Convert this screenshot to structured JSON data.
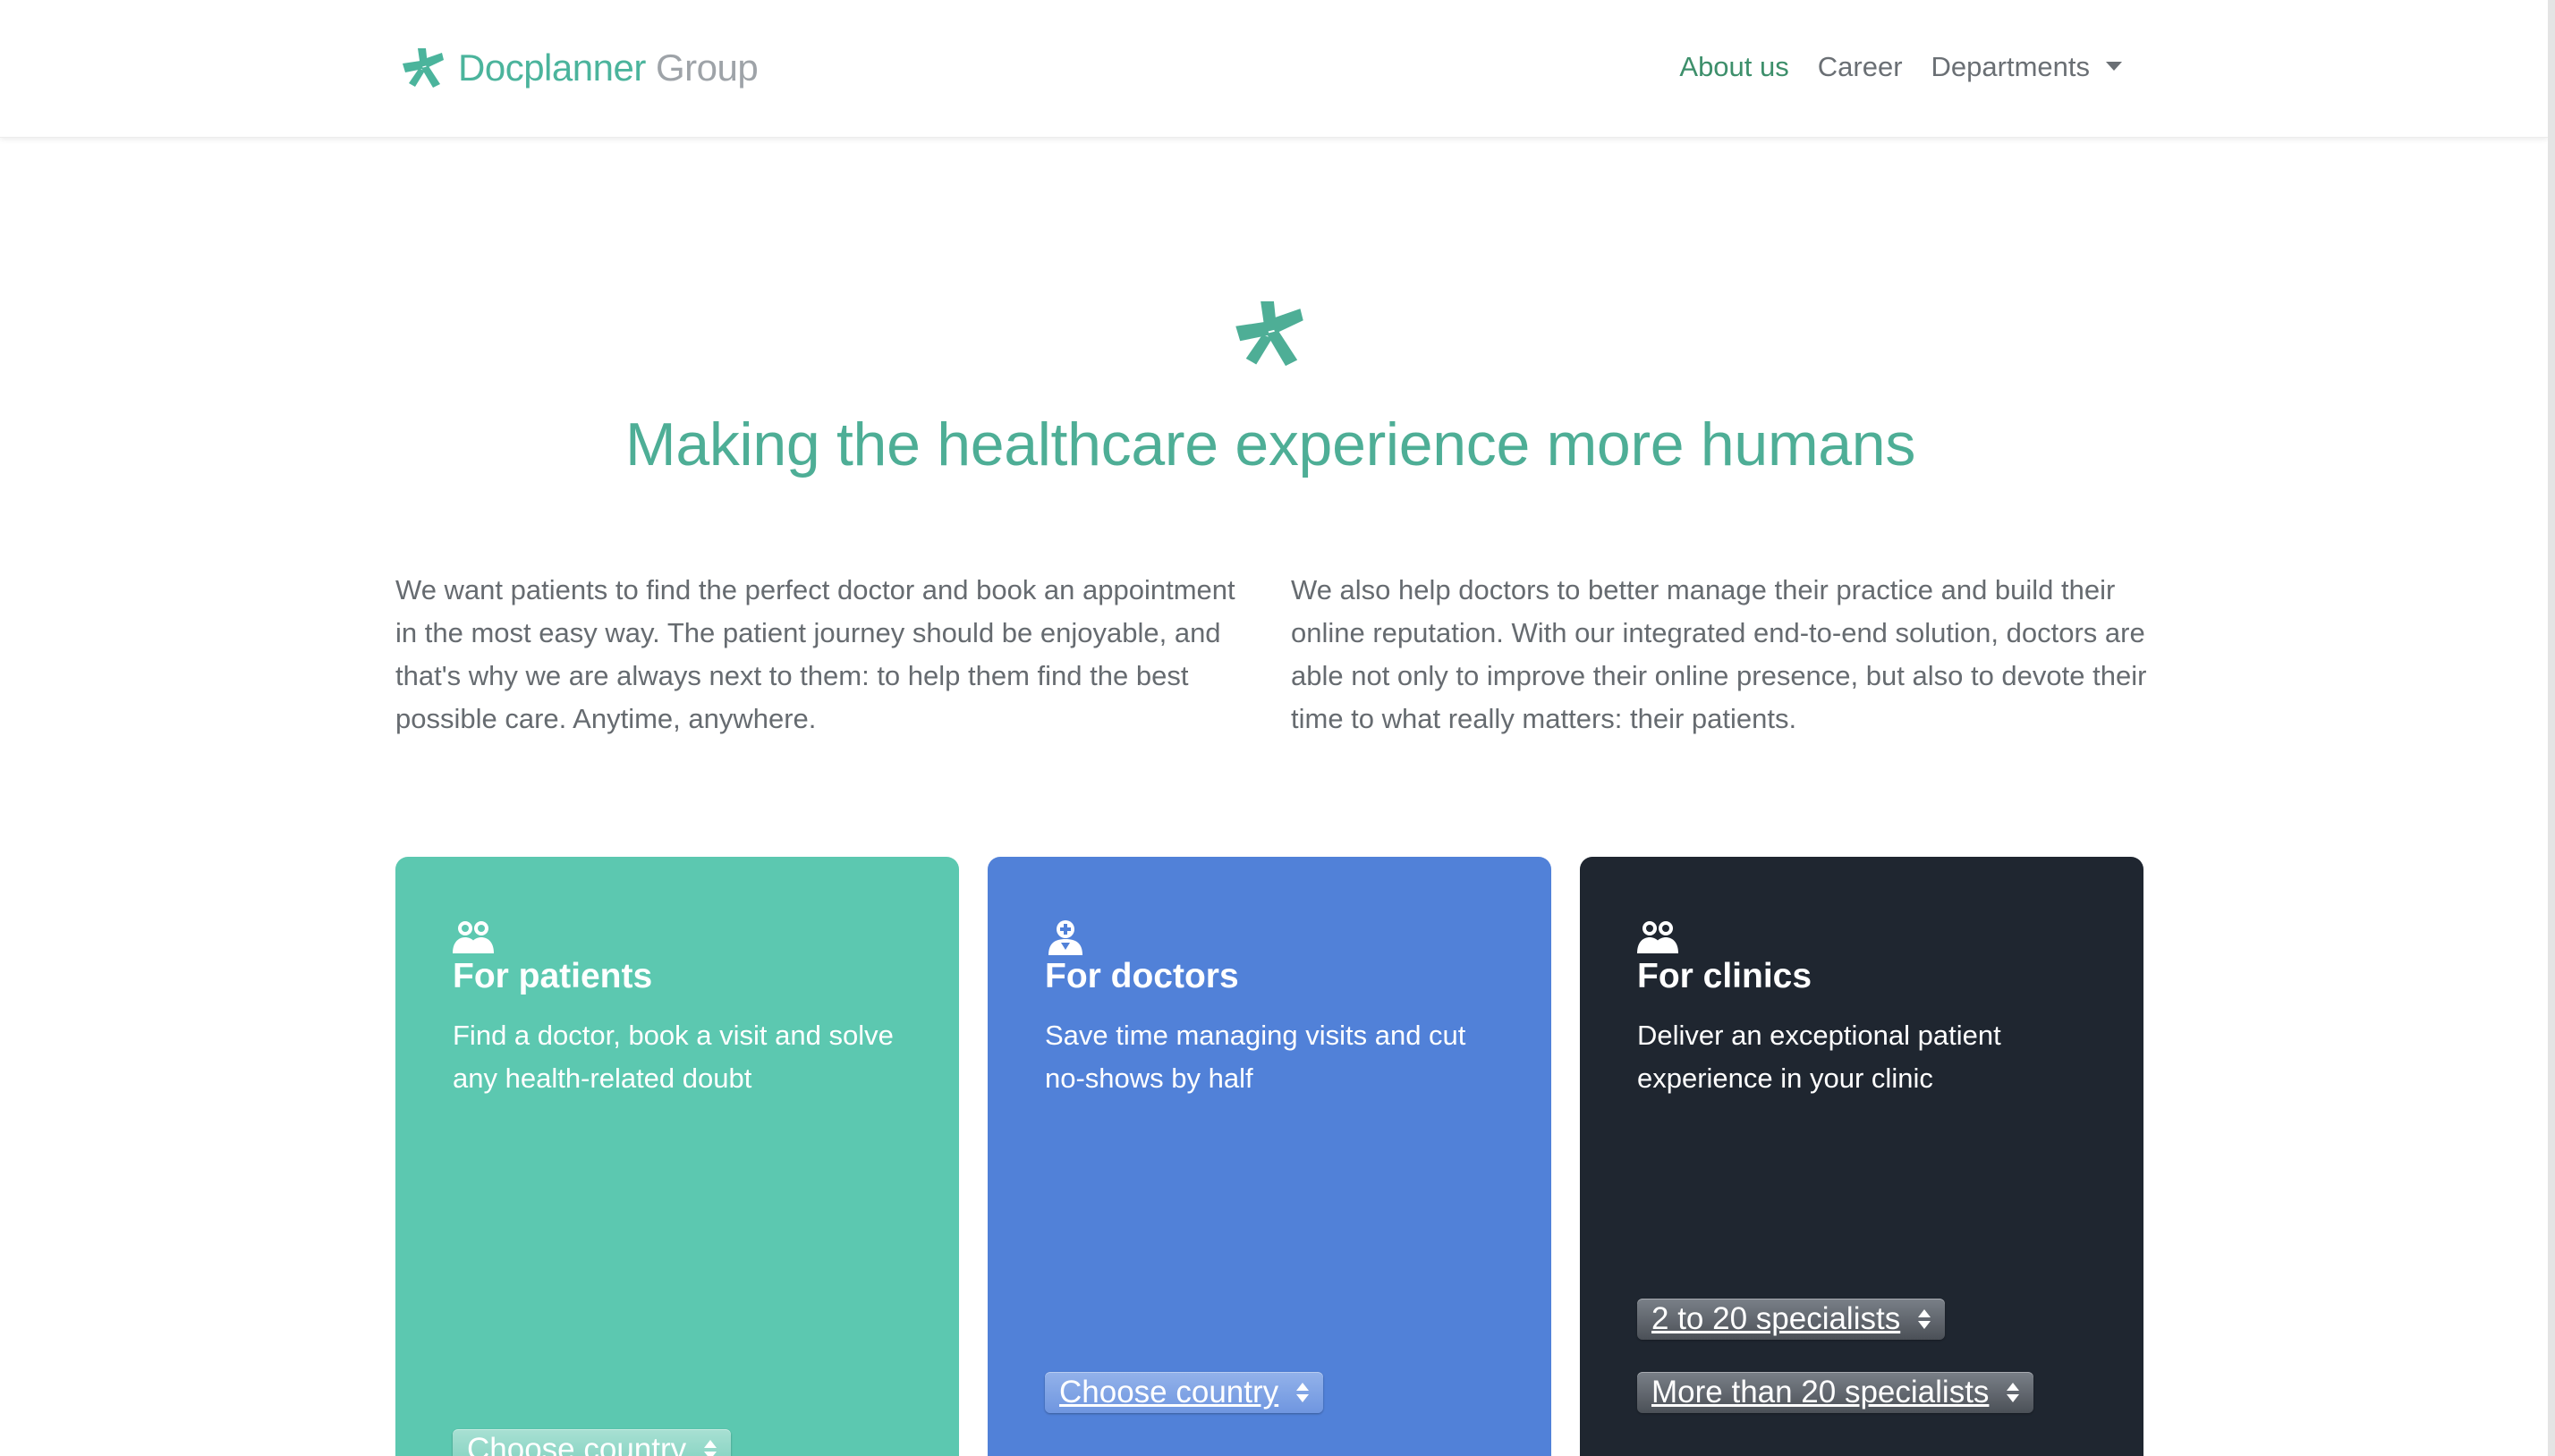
{
  "header": {
    "brand": {
      "primary": "Docplanner",
      "secondary": "Group"
    },
    "nav": {
      "about": "About us",
      "career": "Career",
      "departments": "Departments"
    }
  },
  "hero": {
    "title": "Making the healthcare experience more humans",
    "intro_left": "We want patients to find the perfect doctor and book an appointment in the most easy way. The patient journey should be enjoyable, and that's why we are always next to them: to help them find the best possible care. Anytime, anywhere.",
    "intro_right": "We also help doctors to better manage their practice and build their online reputation. With our integrated end-to-end solution, doctors are able not only to improve their online presence, but also to devote their time to what really matters: their patients."
  },
  "cards": {
    "patients": {
      "title": "For patients",
      "description": "Find a doctor, book a visit and solve any health-related doubt",
      "select": "Choose country",
      "icon": "users-icon"
    },
    "doctors": {
      "title": "For doctors",
      "description": "Save time managing visits and cut no-shows by half",
      "select": "Choose country",
      "icon": "doctor-icon"
    },
    "clinics": {
      "title": "For clinics",
      "description": "Deliver an exceptional patient experience in your clinic",
      "select_small": "2 to 20 specialists",
      "select_large": "More than 20 specialists",
      "icon": "users-icon"
    }
  },
  "colors": {
    "brand_green": "#4bb49c",
    "nav_active": "#3d8f6b",
    "patients_card": "#5cc8b0",
    "doctors_card": "#5181d8",
    "clinics_card": "#1f2630"
  }
}
